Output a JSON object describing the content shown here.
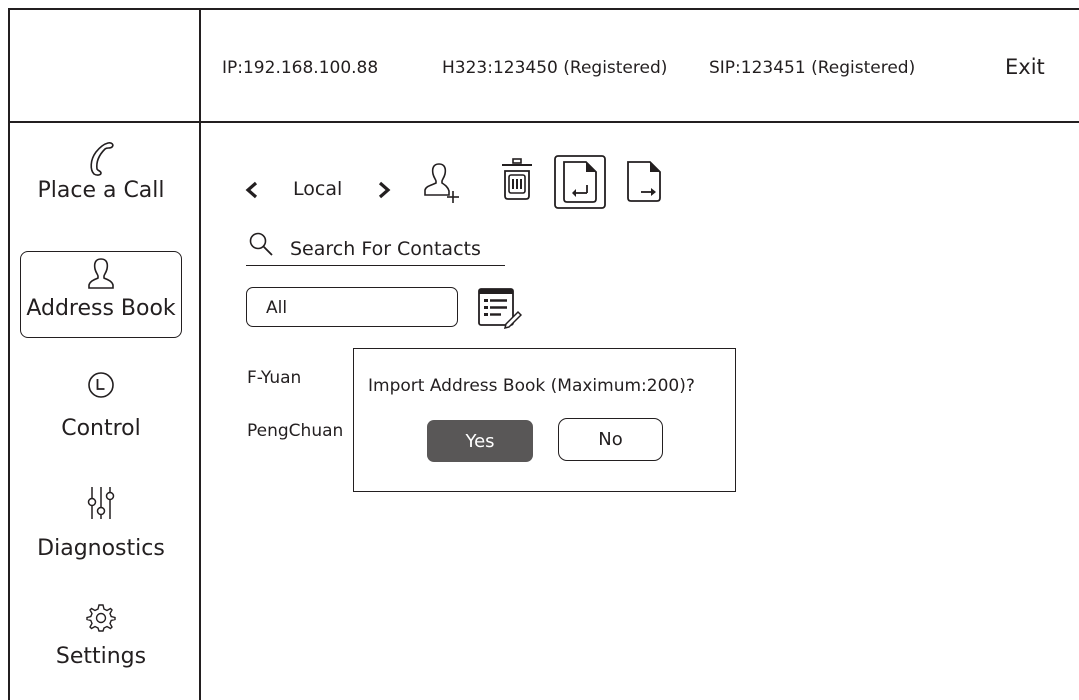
{
  "header": {
    "ip": "IP:192.168.100.88",
    "h323": "H323:123450 (Registered)",
    "sip": "SIP:123451 (Registered)",
    "exit_label": "Exit"
  },
  "sidebar": {
    "items": [
      {
        "label": "Place a Call",
        "icon": "phone-icon"
      },
      {
        "label": "Address Book",
        "icon": "person-icon",
        "active": true
      },
      {
        "label": "Control",
        "icon": "clock-icon"
      },
      {
        "label": "Diagnostics",
        "icon": "sliders-icon"
      },
      {
        "label": "Settings",
        "icon": "gear-icon"
      }
    ]
  },
  "toolbar": {
    "location_label": "Local",
    "icons": [
      "chevron-left-icon",
      "chevron-right-icon",
      "add-contact-icon",
      "trash-icon",
      "import-icon",
      "export-icon"
    ]
  },
  "search": {
    "placeholder": "Search For Contacts"
  },
  "filter": {
    "selected": "All",
    "edit_icon": "edit-list-icon"
  },
  "contacts": [
    {
      "name": "F-Yuan"
    },
    {
      "name": "PengChuan"
    }
  ],
  "dialog": {
    "message": "Import Address Book (Maximum:200)?",
    "yes_label": "Yes",
    "no_label": "No"
  }
}
